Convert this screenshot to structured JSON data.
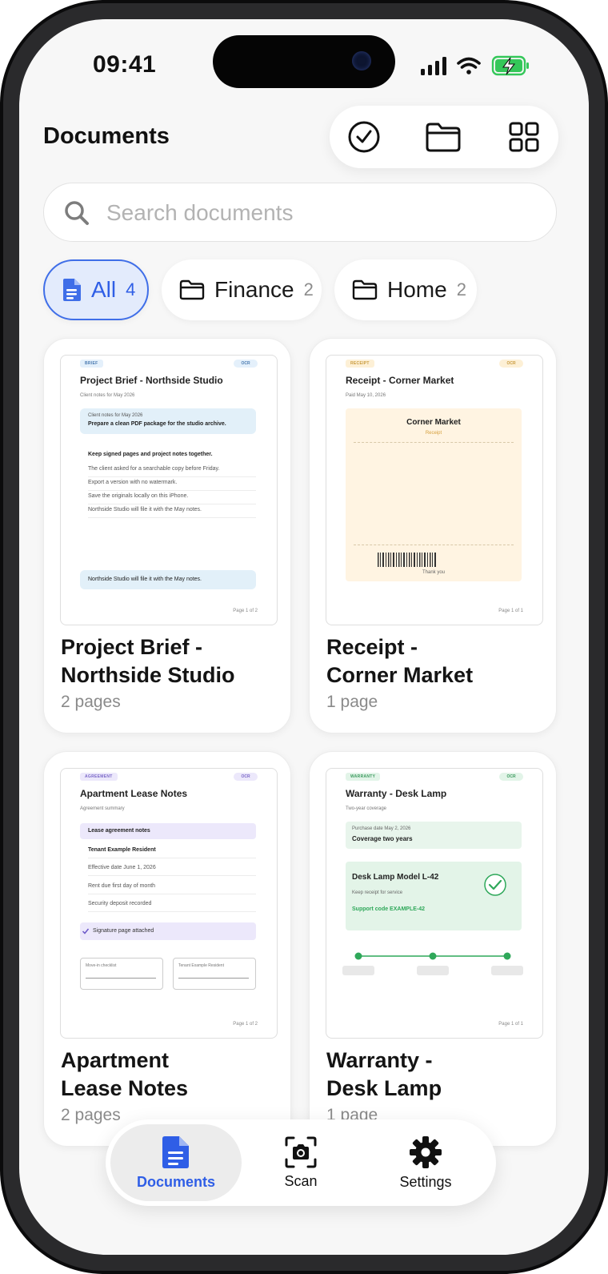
{
  "status": {
    "time": "09:41"
  },
  "header": {
    "title": "Documents"
  },
  "search": {
    "placeholder": "Search documents"
  },
  "filters": [
    {
      "label": "All",
      "count": "4"
    },
    {
      "label": "Finance",
      "count": "2"
    },
    {
      "label": "Home",
      "count": "2"
    }
  ],
  "documents": [
    {
      "name_line1": "Project Brief -",
      "name_line2": "Northside Studio",
      "pages": "2 pages",
      "thumb": {
        "tag": "BRIEF",
        "ocr": "OCR",
        "title": "Project Brief - Northside Studio",
        "subtitle": "Client notes for May 2026",
        "box_small": "Client notes for May 2026",
        "box_main": "Prepare a clean PDF package for the studio archive.",
        "heading": "Keep signed pages and project notes together.",
        "lines": [
          "The client asked for a searchable copy before Friday.",
          "Export a version with no watermark.",
          "Save the originals locally on this iPhone.",
          "Northside Studio will file it with the May notes."
        ],
        "footer": "Northside Studio will file it with the May notes.",
        "page": "Page 1 of 2"
      }
    },
    {
      "name_line1": "Receipt -",
      "name_line2": "Corner Market",
      "pages": "1 page",
      "thumb": {
        "tag": "RECEIPT",
        "ocr": "OCR",
        "title": "Receipt - Corner Market",
        "subtitle": "Paid May 10, 2026",
        "store": "Corner Market",
        "kind": "Receipt",
        "thanks": "Thank you",
        "page": "Page 1 of 1"
      }
    },
    {
      "name_line1": "Apartment",
      "name_line2": "Lease Notes",
      "pages": "2 pages",
      "thumb": {
        "tag": "AGREEMENT",
        "ocr": "OCR",
        "title": "Apartment Lease Notes",
        "subtitle": "Agreement summary",
        "box_main": "Lease agreement notes",
        "lines": [
          "Tenant Example Resident",
          "Effective date June 1, 2026",
          "Rent due first day of month",
          "Security deposit recorded"
        ],
        "check": "Signature page attached",
        "sig_left": "Move-in checklist",
        "sig_right": "Tenant Example Resident",
        "page": "Page 1 of 2"
      }
    },
    {
      "name_line1": "Warranty -",
      "name_line2": "Desk Lamp",
      "pages": "1 page",
      "thumb": {
        "tag": "WARRANTY",
        "ocr": "OCR",
        "title": "Warranty - Desk Lamp",
        "subtitle": "Two-year coverage",
        "box_small": "Purchase date May 2, 2026",
        "box_main": "Coverage two years",
        "product": "Desk Lamp Model L-42",
        "keep": "Keep receipt for service",
        "support": "Support code EXAMPLE-42",
        "page": "Page 1 of 1"
      }
    }
  ],
  "nav": [
    {
      "label": "Documents"
    },
    {
      "label": "Scan"
    },
    {
      "label": "Settings"
    }
  ],
  "colors": {
    "accent": "#2f5ee6",
    "success": "#2fa85a",
    "receipt_bg": "#fff4e2"
  }
}
